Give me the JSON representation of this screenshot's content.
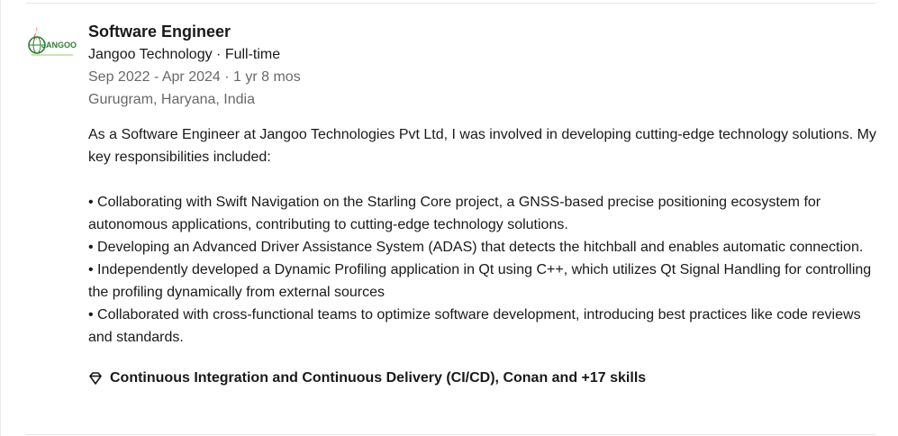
{
  "experience": {
    "logo": {
      "icon": "jangoo-company-logo",
      "text": "JANGOO",
      "brand_color": "#2e7d32",
      "accent_color": "#e53935"
    },
    "title": "Software Engineer",
    "company_line": "Jangoo Technology · Full-time",
    "duration": "Sep 2022 - Apr 2024 · 1 yr 8 mos",
    "location": "Gurugram, Haryana, India",
    "description_intro": "As a Software Engineer at Jangoo Technologies Pvt Ltd, I was involved in developing cutting-edge technology solutions. My key responsibilities included:",
    "bullets": [
      "• Collaborating with Swift Navigation on the Starling Core project, a GNSS-based precise positioning ecosystem for autonomous applications, contributing to cutting-edge technology solutions.",
      "• Developing an Advanced Driver Assistance System (ADAS) that detects the hitchball and enables automatic connection.",
      "• Independently developed a Dynamic Profiling application in Qt using C++, which utilizes Qt Signal Handling for controlling the profiling dynamically from external sources",
      "• Collaborated with cross-functional teams to optimize software development, introducing best practices like code reviews and standards."
    ],
    "skills": {
      "icon": "diamond-icon",
      "label": "Continuous Integration and Continuous Delivery (CI/CD), Conan and +17 skills"
    }
  }
}
